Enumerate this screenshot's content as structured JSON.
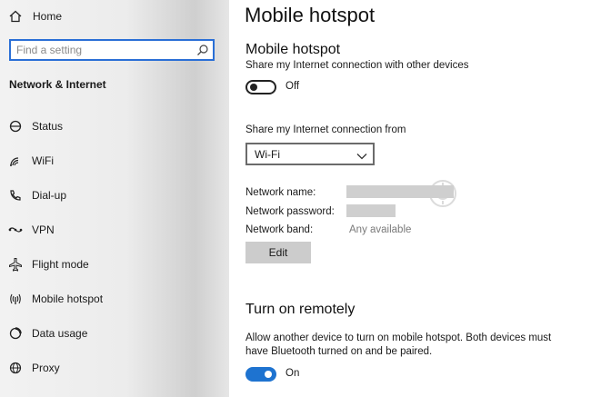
{
  "sidebar": {
    "home_label": "Home",
    "search_placeholder": "Find a setting",
    "section_title": "Network & Internet",
    "items": [
      {
        "label": "Status",
        "icon": "status-icon"
      },
      {
        "label": "WiFi",
        "icon": "wifi-icon"
      },
      {
        "label": "Dial-up",
        "icon": "dialup-icon"
      },
      {
        "label": "VPN",
        "icon": "vpn-icon"
      },
      {
        "label": "Flight mode",
        "icon": "airplane-icon"
      },
      {
        "label": "Mobile hotspot",
        "icon": "hotspot-icon"
      },
      {
        "label": "Data usage",
        "icon": "data-usage-icon"
      },
      {
        "label": "Proxy",
        "icon": "proxy-icon"
      }
    ]
  },
  "main": {
    "page_title": "Mobile hotspot",
    "hotspot": {
      "heading": "Mobile hotspot",
      "description": "Share my Internet connection with other devices",
      "toggle_state": "Off"
    },
    "share_from": {
      "label": "Share my Internet connection from",
      "selected": "Wi-Fi"
    },
    "network": {
      "name_label": "Network name:",
      "password_label": "Network password:",
      "band_label": "Network band:",
      "band_value": "Any available",
      "edit_label": "Edit"
    },
    "remote": {
      "heading": "Turn on remotely",
      "description_line1": "Allow another device to turn on mobile hotspot. Both devices must",
      "description_line2": "have Bluetooth turned on and be paired.",
      "toggle_state": "On"
    }
  },
  "colors": {
    "accent": "#1e73d0",
    "search_border": "#2a6fd6"
  }
}
